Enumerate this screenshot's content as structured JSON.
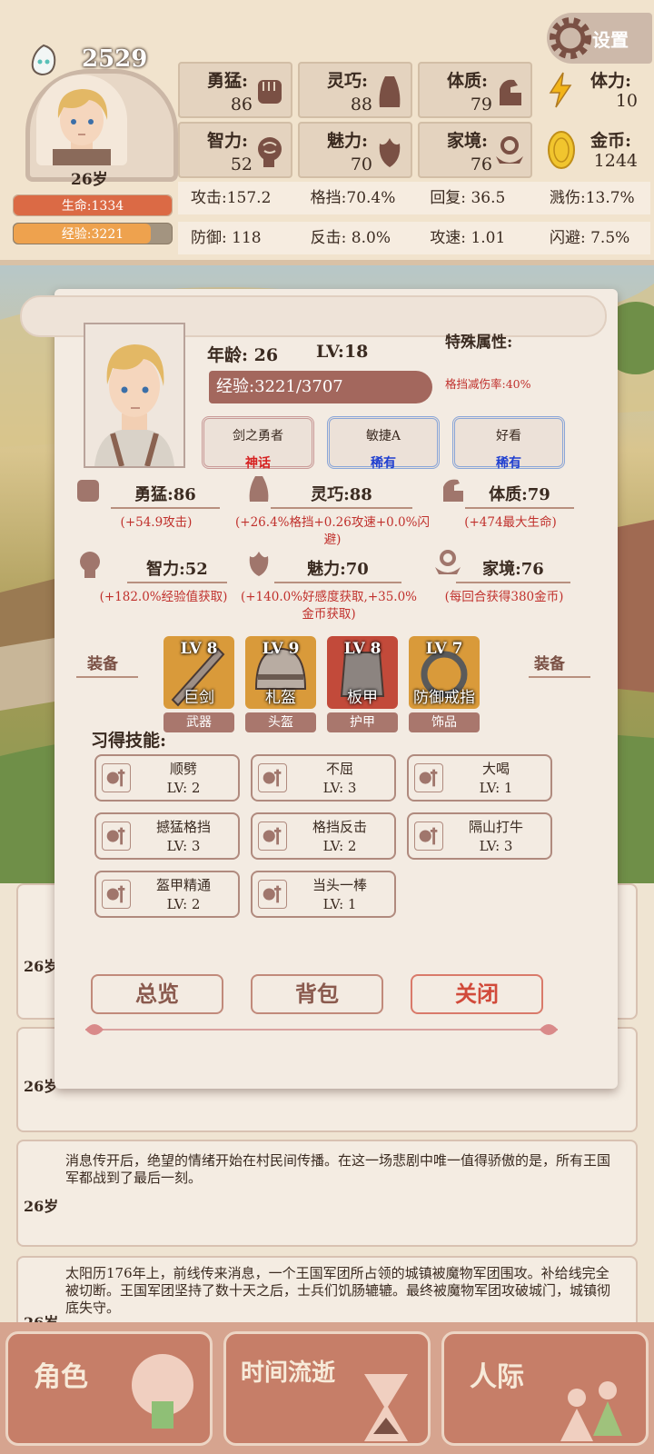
{
  "header": {
    "score": "2529",
    "settings_label": "设置",
    "age_small": "26岁",
    "life": "生命:1334",
    "life_fraction": 1.0,
    "exp": "经验:3221",
    "exp_fraction": 0.87,
    "stats": [
      {
        "label": "勇猛:",
        "value": "86",
        "icon": "fist-icon"
      },
      {
        "label": "灵巧:",
        "value": "88",
        "icon": "cloak-icon"
      },
      {
        "label": "体质:",
        "value": "79",
        "icon": "arm-icon"
      },
      {
        "label": "智力:",
        "value": "52",
        "icon": "brain-icon"
      },
      {
        "label": "魅力:",
        "value": "70",
        "icon": "tulip-icon"
      },
      {
        "label": "家境:",
        "value": "76",
        "icon": "coin-hand-icon"
      }
    ],
    "stamina_label": "体力:",
    "stamina_value": "10",
    "gold_label": "金币:",
    "gold_value": "1244",
    "sub_stats_row1": [
      "攻击:157.2",
      "格挡:70.4%",
      "回复:   36.5",
      "溅伤:13.7%"
    ],
    "sub_stats_row2": [
      "防御:  118",
      "反击:  8.0%",
      "攻速:  1.01",
      "闪避:  7.5%"
    ]
  },
  "panel": {
    "age": "年龄: 26",
    "level": "LV:18",
    "special_title": "特殊属性:",
    "special_value": "格挡减伤率:40%",
    "exp_text": "经验:3221/3707",
    "traits": [
      {
        "name": "剑之勇者",
        "rarity": "神话",
        "color": "#d62020"
      },
      {
        "name": "敏捷A",
        "rarity": "稀有",
        "color": "#1f3fd0"
      },
      {
        "name": "好看",
        "rarity": "稀有",
        "color": "#1f3fd0"
      }
    ],
    "attributes": [
      {
        "title": "勇猛:86",
        "desc": "(+54.9攻击)"
      },
      {
        "title": "灵巧:88",
        "desc": "(+26.4%格挡+0.26攻速+0.0%闪避)"
      },
      {
        "title": "体质:79",
        "desc": "(+474最大生命)"
      },
      {
        "title": "智力:52",
        "desc": "(+182.0%经验值获取)"
      },
      {
        "title": "魅力:70",
        "desc": "(+140.0%好感度获取,+35.0%金币获取)"
      },
      {
        "title": "家境:76",
        "desc": "(每回合获得380金币)"
      }
    ],
    "equip_label_left": "装备",
    "equip_label_right": "装备",
    "equipment": [
      {
        "lv": "LV 8",
        "name": "巨剑",
        "slot": "武器"
      },
      {
        "lv": "LV 9",
        "name": "札盔",
        "slot": "头盔"
      },
      {
        "lv": "LV 8",
        "name": "板甲",
        "slot": "护甲"
      },
      {
        "lv": "LV 7",
        "name": "防御戒指",
        "slot": "饰品"
      }
    ],
    "skills_title": "习得技能:",
    "skills": [
      {
        "name": "顺劈",
        "lv": "LV: 2"
      },
      {
        "name": "不屈",
        "lv": "LV: 3"
      },
      {
        "name": "大喝",
        "lv": "LV: 1"
      },
      {
        "name": "撼猛格挡",
        "lv": "LV: 3"
      },
      {
        "name": "格挡反击",
        "lv": "LV: 2"
      },
      {
        "name": "隔山打牛",
        "lv": "LV: 3"
      },
      {
        "name": "盔甲精通",
        "lv": "LV: 2"
      },
      {
        "name": "当头一棒",
        "lv": "LV: 1"
      }
    ],
    "buttons": {
      "overview": "总览",
      "bag": "背包",
      "close": "关闭"
    }
  },
  "log": [
    {
      "age": "26岁",
      "text": ""
    },
    {
      "age": "26岁",
      "text": ""
    },
    {
      "age": "26岁",
      "text": "消息传开后，绝望的情绪开始在村民间传播。在这一场悲剧中唯一值得骄傲的是，所有王国军都战到了最后一刻。"
    },
    {
      "age": "26岁",
      "text": "太阳历176年上，前线传来消息，一个王国军团所占领的城镇被魔物军团围攻。补给线完全被切断。王国军团坚持了数十天之后，士兵们饥肠辘辘。最终被魔物军团攻破城门，城镇彻底失守。"
    }
  ],
  "tabs": [
    {
      "label": "角色",
      "icon": "head-icon"
    },
    {
      "label": "时间流逝",
      "icon": "hourglass-icon"
    },
    {
      "label": "人际",
      "icon": "people-icon"
    }
  ]
}
